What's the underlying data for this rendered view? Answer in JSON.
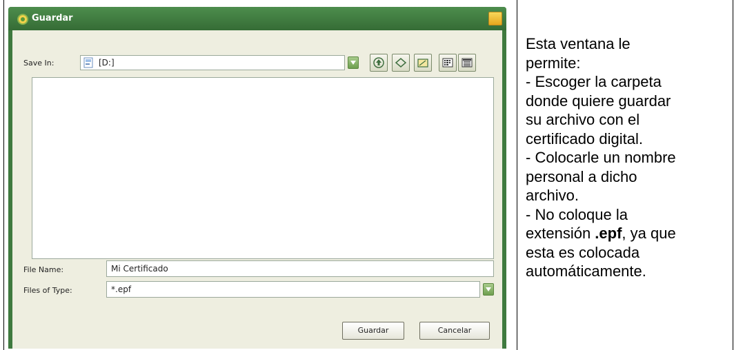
{
  "dialog": {
    "title": "Guardar",
    "save_in_label": "Save In:",
    "save_in_value": "[D:]",
    "toolbar": {
      "icons": [
        "up-folder-icon",
        "home-icon",
        "new-folder-icon",
        "list-view-icon",
        "details-view-icon"
      ]
    },
    "file_name_label": "File Name:",
    "file_name_value": "Mi Certificado",
    "files_of_type_label": "Files of Type:",
    "files_of_type_value": "*.epf",
    "save_button": "Guardar",
    "cancel_button": "Cancelar",
    "colors": {
      "frame": "#3f7a3f",
      "client": "#eeeee0",
      "accent_arrow": "#6e9f4f",
      "close": "#e6a61d"
    }
  },
  "description": {
    "line1": "Esta ventana le",
    "line2": "permite:",
    "line3": "- Escoger la carpeta",
    "line4": "donde quiere guardar",
    "line5": "su archivo con el",
    "line6": "certificado digital.",
    "line7": "- Colocarle un nombre",
    "line8": "personal a dicho",
    "line9": "archivo.",
    "line10": "- No coloque la",
    "line11_pre": "extensión ",
    "line11_bold": ".epf",
    "line11_post": ", ya que",
    "line12": "esta es colocada",
    "line13": "automáticamente."
  }
}
